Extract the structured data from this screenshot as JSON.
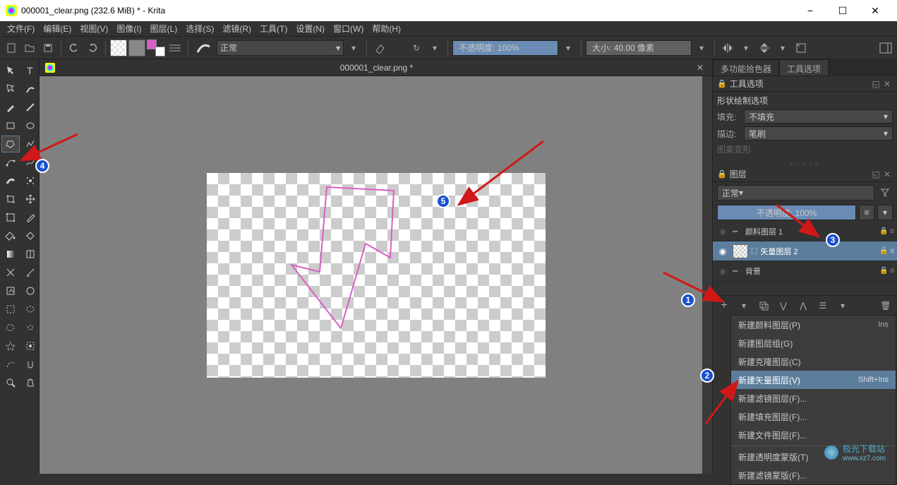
{
  "window": {
    "title": "000001_clear.png (232.6 MiB)  * - Krita"
  },
  "menu": [
    "文件(F)",
    "编辑(E)",
    "视图(V)",
    "图像(I)",
    "图层(L)",
    "选择(S)",
    "滤镜(R)",
    "工具(T)",
    "设置(N)",
    "窗口(W)",
    "帮助(H)"
  ],
  "toolbar": {
    "blend_mode": "正常",
    "opacity_label": "不透明度:  100%",
    "size_label": "大小:",
    "size_value": "40.00 像素"
  },
  "document_tab": {
    "label": "000001_clear.png *"
  },
  "right_tabs": [
    "多功能拾色器",
    "工具选项"
  ],
  "tool_options": {
    "title": "工具选项",
    "section": "形状绘制选项",
    "fill_label": "填充:",
    "fill_value": "不填充",
    "stroke_label": "描边:",
    "stroke_value": "笔刷",
    "transform_label": "图案变形"
  },
  "layers": {
    "title": "图层",
    "blend_mode": "正常",
    "opacity_label": "不透明度: 100%",
    "items": [
      {
        "name": "颜料图层 1",
        "visible": false,
        "selected": false
      },
      {
        "name": "矢量图层 2",
        "visible": true,
        "selected": true
      },
      {
        "name": "背景",
        "visible": false,
        "selected": false
      }
    ]
  },
  "context_menu": {
    "items": [
      {
        "label": "新建颜料图层(P)",
        "shortcut": "Ins"
      },
      {
        "label": "新建图层组(G)",
        "shortcut": ""
      },
      {
        "label": "新建克隆图层(C)",
        "shortcut": ""
      },
      {
        "label": "新建矢量图层(V)",
        "shortcut": "Shift+Ins",
        "highlight": true
      },
      {
        "label": "新建滤镜图层(F)...",
        "shortcut": ""
      },
      {
        "label": "新建填充图层(F)...",
        "shortcut": ""
      },
      {
        "label": "新建文件图层(F)...",
        "shortcut": ""
      }
    ],
    "extra": [
      {
        "label": "新建透明度蒙版(T)"
      },
      {
        "label": "新建滤镜蒙版(F)..."
      }
    ]
  },
  "watermark": {
    "brand": "极光下载站",
    "url": "www.xz7.com"
  },
  "annotations": {
    "badges": {
      "1": "1",
      "2": "2",
      "3": "3",
      "4": "4",
      "5": "5"
    }
  }
}
